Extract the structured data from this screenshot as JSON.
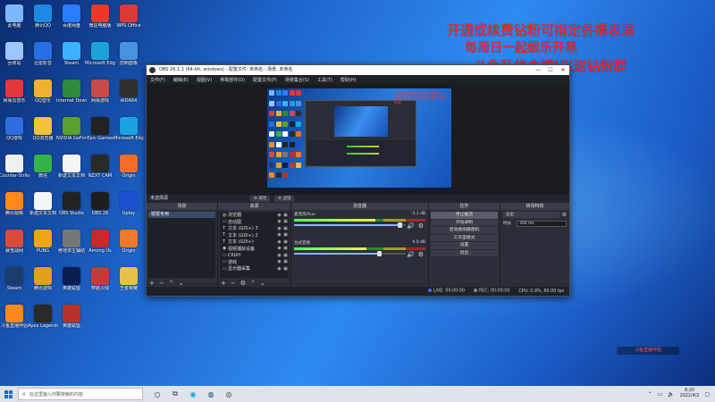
{
  "desktop": {
    "icons": [
      {
        "label": "此电脑",
        "color": "#7db7ff"
      },
      {
        "label": "腾讯QQ",
        "color": "#1e88e5"
      },
      {
        "label": "百度网盘",
        "color": "#2b7bff"
      },
      {
        "label": "微信电脑版",
        "color": "#e63a2a"
      },
      {
        "label": "WPS Office",
        "color": "#d83a3a"
      },
      {
        "label": "回收站",
        "color": "#9fc5ff"
      },
      {
        "label": "迅雷影音",
        "color": "#2a6ee6"
      },
      {
        "label": "Steam",
        "color": "#3ab2ff"
      },
      {
        "label": "Microsoft Edge",
        "color": "#1ca1d9"
      },
      {
        "label": "控制面板",
        "color": "#4a90e2"
      },
      {
        "label": "网易云音乐",
        "color": "#e23a3a"
      },
      {
        "label": "QQ音乐",
        "color": "#f1b12d"
      },
      {
        "label": "Internet Download",
        "color": "#2c8c3c"
      },
      {
        "label": "网易游戏",
        "color": "#c84a4a"
      },
      {
        "label": "AIDA64",
        "color": "#303030"
      },
      {
        "label": "QQ游戏",
        "color": "#2d6de0"
      },
      {
        "label": "QQ浏览器",
        "color": "#f2c23a"
      },
      {
        "label": "NVIDIA GeForce",
        "color": "#5aa02c"
      },
      {
        "label": "Epic Games",
        "color": "#222222"
      },
      {
        "label": "Microsoft Edge",
        "color": "#1aa3e0"
      },
      {
        "label": "Counter-Strike",
        "color": "#f0f0f0"
      },
      {
        "label": "微信",
        "color": "#33b34a"
      },
      {
        "label": "新建文本文档",
        "color": "#f5f5f5"
      },
      {
        "label": "NZXT CAM",
        "color": "#2a2a2a"
      },
      {
        "label": "Origin",
        "color": "#f26c2a"
      },
      {
        "label": "腾讯视频",
        "color": "#ff8a1a"
      },
      {
        "label": "新建文本文档",
        "color": "#f5f5f5"
      },
      {
        "label": "OBS Studio",
        "color": "#222222"
      },
      {
        "label": "OBS 26",
        "color": "#1e1e1e"
      },
      {
        "label": "Uplay",
        "color": "#1d4fd1"
      },
      {
        "label": "暴雪战网",
        "color": "#d94a3a"
      },
      {
        "label": "PUBG",
        "color": "#f2a418"
      },
      {
        "label": "绝地求生辅助",
        "color": "#777777"
      },
      {
        "label": "Among Us",
        "color": "#c62a2a"
      },
      {
        "label": "Origin",
        "color": "#f07a2a"
      },
      {
        "label": "Steam",
        "color": "#1b3d6e"
      },
      {
        "label": "腾讯游戏",
        "color": "#e0a020"
      },
      {
        "label": "英雄联盟",
        "color": "#0a1e50"
      },
      {
        "label": "穿越火线",
        "color": "#c23a3a"
      },
      {
        "label": "王者荣耀",
        "color": "#e8c14a"
      },
      {
        "label": "斗鱼直播伴侣",
        "color": "#ff8a1a"
      },
      {
        "label": "Apex Legends",
        "color": "#2a2a2a"
      },
      {
        "label": "英雄联盟",
        "color": "#b8302a"
      }
    ],
    "promo_lines": [
      "开通或续费钻粉可指定各播表演",
      "每周日一起娱乐开黑",
      "斗鱼私信主播VX送钻粉群"
    ],
    "badge_text": "斗鱼直播伴侣"
  },
  "obs": {
    "title": "OBS 26.1.1 (64-bit, windows) - 配置文件: 未命名 - 场景: 未命名",
    "window_controls": [
      "—",
      "☐",
      "✕"
    ],
    "menu": [
      "文件(F)",
      "编辑(E)",
      "视图(V)",
      "停靠部件(D)",
      "配置文件(P)",
      "场景集合(S)",
      "工具(T)",
      "帮助(H)"
    ],
    "preview_mini_promo": "开通或续费钻粉可指定 每周日一起娱乐开黑 斗鱼私信主播VX送钻粉群",
    "dock_bar": {
      "no_source": "未选择源",
      "properties": "属性",
      "filters": "滤镜"
    },
    "scenes": {
      "title": "场景",
      "items": [
        "斑斑专用"
      ]
    },
    "sources": {
      "title": "来源",
      "items": [
        {
          "icon": "globe",
          "name": "浏览器"
        },
        {
          "icon": "display",
          "name": "自动图"
        },
        {
          "icon": "text",
          "name": "文本 (GDI+) 3"
        },
        {
          "icon": "text",
          "name": "文本 (GDI+) 2"
        },
        {
          "icon": "text",
          "name": "文本 (GDI+)"
        },
        {
          "icon": "camera",
          "name": "视频捕获设备"
        },
        {
          "icon": "display",
          "name": "CKUH"
        },
        {
          "icon": "display",
          "name": "游戏"
        },
        {
          "icon": "display",
          "name": "显示器采集"
        }
      ]
    },
    "mixer": {
      "title": "混音器",
      "channels": [
        {
          "name": "麦克风/Aux",
          "db": "-3.1 dB",
          "level": 0.62,
          "volume": 0.94
        },
        {
          "name": "台式音频",
          "db": "0.0 dB",
          "level": 0.55,
          "volume": 0.76
        }
      ]
    },
    "controls": {
      "title": "控件",
      "buttons": [
        "停止推流",
        "开始录制",
        "启动虚拟摄像机",
        "工作室模式",
        "设置",
        "退出"
      ]
    },
    "transitions": {
      "title": "转场特效",
      "type": "淡出",
      "duration_label": "时长",
      "duration_value": "300 ms"
    },
    "status": {
      "live": "LIVE: 00:00:00",
      "rec": "REC: 00:00:00",
      "cpu": "CPU: 0.9%, 60.00 fps"
    },
    "colors": {
      "live_dot": "#3d6fff",
      "rec_dot": "#888888"
    }
  },
  "taskbar": {
    "search_placeholder": "在这里输入你要搜索的内容",
    "time": "8:20",
    "date": "2022/4/2"
  }
}
